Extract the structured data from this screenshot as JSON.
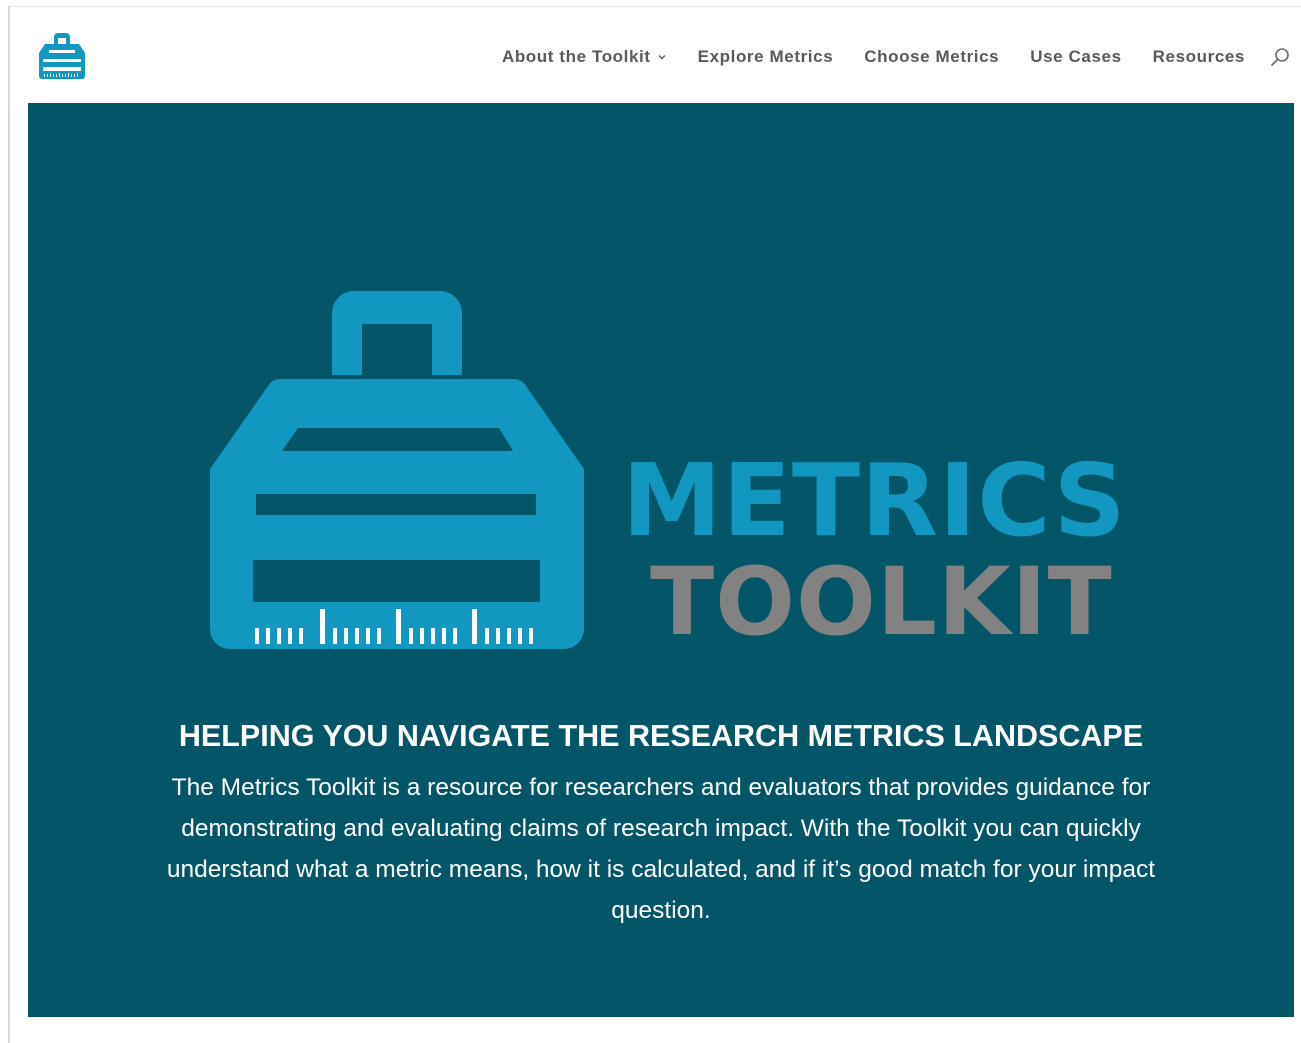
{
  "header": {
    "logo_icon": "toolbox-icon",
    "nav": [
      {
        "label": "About the Toolkit",
        "has_dropdown": true
      },
      {
        "label": "Explore Metrics",
        "has_dropdown": false
      },
      {
        "label": "Choose Metrics",
        "has_dropdown": false
      },
      {
        "label": "Use Cases",
        "has_dropdown": false
      },
      {
        "label": "Resources",
        "has_dropdown": false
      }
    ],
    "search_icon": "search-icon"
  },
  "hero": {
    "logo_line1": "METRICS",
    "logo_line2": "TOOLKIT",
    "heading": "HELPING YOU NAVIGATE THE RESEARCH METRICS LANDSCAPE",
    "description": "The Metrics Toolkit is a resource for researchers and evaluators that provides guidance for demonstrating and evaluating claims of research impact.  With the Toolkit you can quickly understand what a metric means, how it is calculated, and if it’s good match for your impact question."
  },
  "colors": {
    "hero_background": "#045568",
    "brand_blue": "#1197c0",
    "brand_gray": "#828282",
    "nav_text": "#5a5a5a"
  }
}
